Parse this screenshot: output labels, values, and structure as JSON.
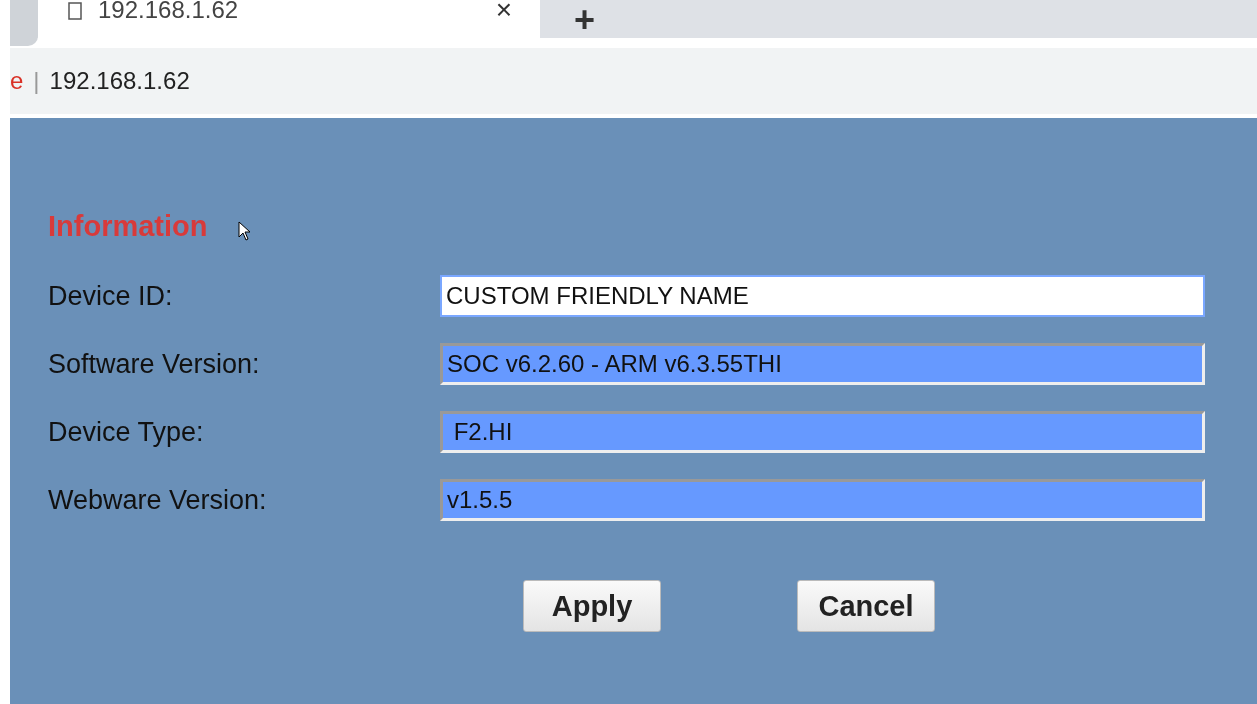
{
  "browser": {
    "tab": {
      "title": "192.168.1.62",
      "close": "×",
      "new_tab": "+"
    },
    "address_bar": {
      "security": "e",
      "separator": "|",
      "url": "192.168.1.62"
    }
  },
  "section": {
    "title": "Information"
  },
  "fields": [
    {
      "label": "Device ID:",
      "value": "CUSTOM FRIENDLY NAME",
      "readonly": false
    },
    {
      "label": "Software Version:",
      "value": "SOC v6.2.60 - ARM v6.3.55THI",
      "readonly": true
    },
    {
      "label": "Device Type:",
      "value": " F2.HI",
      "readonly": true
    },
    {
      "label": "Webware Version:",
      "value": "v1.5.5",
      "readonly": true
    }
  ],
  "buttons": [
    "Apply",
    "Cancel"
  ]
}
